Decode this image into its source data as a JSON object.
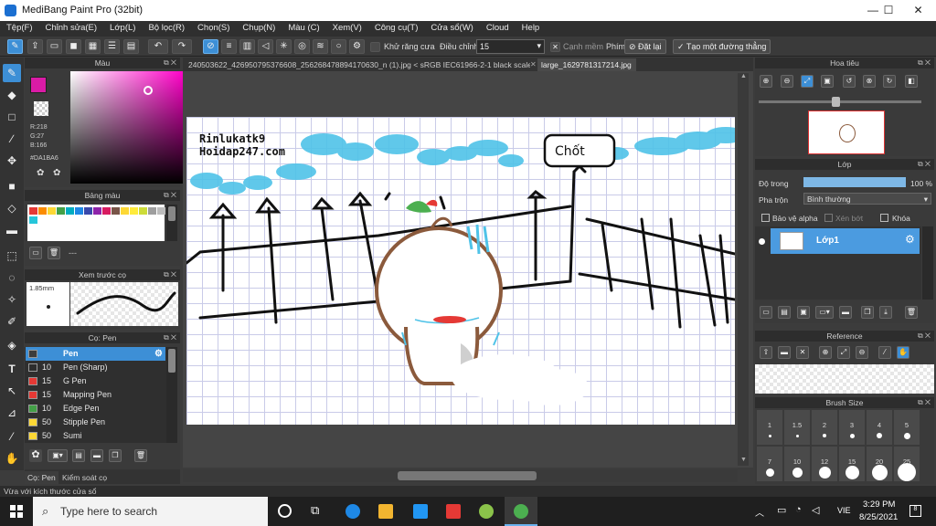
{
  "window": {
    "title": "MediBang Paint Pro (32bit)",
    "minimize": "—",
    "maximize": "☐",
    "close": "✕"
  },
  "menu": [
    "Tệp(F)",
    "Chỉnh sửa(E)",
    "Lớp(L)",
    "Bộ lọc(R)",
    "Chọn(S)",
    "Chụp(N)",
    "Màu (C)",
    "Xem(V)",
    "Công cụ(T)",
    "Cửa sổ(W)",
    "Cloud",
    "Help"
  ],
  "toolbar": {
    "antialias_label": "Khử răng cưa",
    "adjust_label": "Điều chỉnh",
    "adjust_value": "15",
    "edge_label": "Cạnh mềm",
    "key_label": "Phím",
    "reset_label": "Đặt lại",
    "straight_label": "Tạo một đường thẳng"
  },
  "color_panel": {
    "title": "Màu",
    "r": "R:218",
    "g": "G:27",
    "b": "B:166",
    "hex": "#DA1BA6",
    "current_color": "#da1ba6"
  },
  "palette_panel": {
    "title": "Bảng màu",
    "swatches": [
      "#e53935",
      "#fb8c00",
      "#fdd835",
      "#43a047",
      "#00acc1",
      "#1e88e5",
      "#3949ab",
      "#8e24aa",
      "#d81b60",
      "#795548",
      "#fdd835",
      "#ffeb3b",
      "#cddc39",
      "#9e9e9e",
      "#bdbdbd",
      "#26c6da"
    ],
    "footer": "---"
  },
  "preview_panel": {
    "title": "Xem trước cọ",
    "size": "1.85mm"
  },
  "brush_panel": {
    "title": "Cọ: Pen",
    "items": [
      {
        "size": "",
        "name": "Pen",
        "color": "#3d3d3d",
        "selected": true
      },
      {
        "size": "10",
        "name": "Pen (Sharp)",
        "color": "#2d2d2d"
      },
      {
        "size": "15",
        "name": "G Pen",
        "color": "#e53935"
      },
      {
        "size": "15",
        "name": "Mapping Pen",
        "color": "#e53935"
      },
      {
        "size": "10",
        "name": "Edge Pen",
        "color": "#43a047"
      },
      {
        "size": "50",
        "name": "Stipple Pen",
        "color": "#fdd835"
      },
      {
        "size": "50",
        "name": "Sumi",
        "color": "#fdd835"
      }
    ],
    "tab1": "Cọ: Pen",
    "tab2": "Kiểm soát cọ"
  },
  "doc_tabs": [
    "240503622_426950795376608_256268478894170630_n (1).jpg < sRGB IEC61966-2-1 black scaled >",
    "large_1629781317214.jpg"
  ],
  "canvas_text": {
    "watermark1": "Rinlukatk9",
    "watermark2": "Hoidap247.com",
    "sign": "Chốt"
  },
  "navigator": {
    "title": "Hoa tiêu"
  },
  "layer_panel": {
    "title": "Lớp",
    "opacity_label": "Độ trong",
    "opacity_value": "100 %",
    "opacity": 1.0,
    "blend_label": "Pha trộn",
    "blend_value": "Bình thường",
    "protect_alpha": "Bảo vệ alpha",
    "clip": "Xén bớt",
    "lock": "Khóa",
    "layers": [
      {
        "name": "Lớp1"
      }
    ]
  },
  "reference_panel": {
    "title": "Reference"
  },
  "brush_size_panel": {
    "title": "Brush Size",
    "row1": [
      "1",
      "1.5",
      "2",
      "3",
      "4",
      "5"
    ],
    "row2": [
      "7",
      "10",
      "12",
      "15",
      "20",
      "25"
    ]
  },
  "statusbar": {
    "text": "Vừa với kích thước cửa sổ"
  },
  "taskbar": {
    "search_placeholder": "Type here to search",
    "time": "3:29 PM",
    "date": "8/25/2021",
    "lang": "VIE",
    "notifications": "8"
  }
}
